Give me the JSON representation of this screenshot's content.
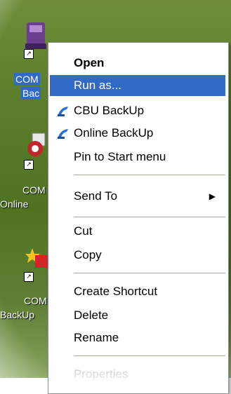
{
  "desktop": {
    "icons": [
      {
        "label_line1": "COM",
        "label_line2": "Bac",
        "selected": true
      },
      {
        "label_line1": "COM",
        "label_line2": "Online"
      },
      {
        "label_line1": "COM",
        "label_line2": "BackUp"
      }
    ]
  },
  "context_menu": {
    "items": [
      {
        "label": "Open",
        "bold": true
      },
      {
        "label": "Run as...",
        "highlighted": true
      },
      {
        "label": "CBU BackUp",
        "icon": "backup-icon"
      },
      {
        "label": "Online BackUp",
        "icon": "backup-icon"
      },
      {
        "label": "Pin to Start menu"
      },
      {
        "label": "Send To",
        "submenu": true
      },
      {
        "label": "Cut"
      },
      {
        "label": "Copy"
      },
      {
        "label": "Create Shortcut"
      },
      {
        "label": "Delete"
      },
      {
        "label": "Rename"
      },
      {
        "label": "Properties",
        "disabled": true
      }
    ],
    "submenu_arrow": "▶"
  },
  "colors": {
    "highlight": "#316ac5",
    "separator": "#aca899"
  }
}
